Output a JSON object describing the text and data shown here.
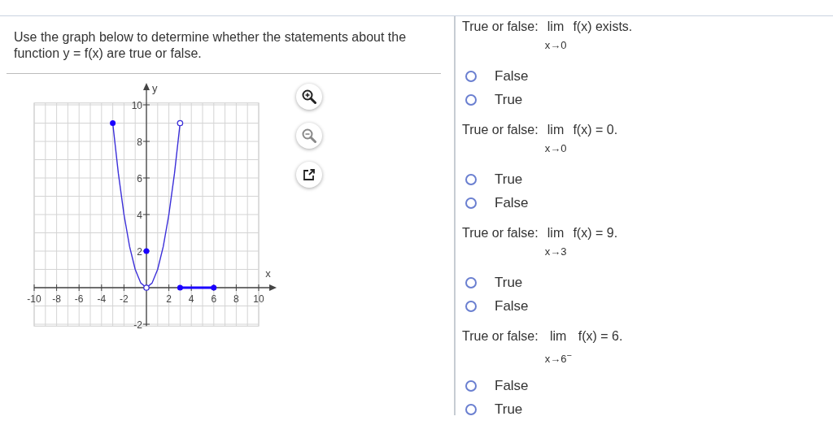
{
  "instructions": "Use the graph below to determine whether the statements about the function y = f(x) are true or false.",
  "graph": {
    "tools": [
      {
        "kind": "zoom-in"
      },
      {
        "kind": "zoom-out"
      },
      {
        "kind": "open"
      }
    ],
    "chart_data": {
      "type": "line",
      "xlabel": "x",
      "ylabel": "y",
      "grid": true,
      "x": [
        -3,
        -2.5,
        -2,
        -1.5,
        -1,
        -0.5,
        0,
        0.5,
        1,
        1.5,
        2,
        2.5,
        3,
        4,
        5,
        6
      ],
      "series": [
        {
          "color": "#3b2fd9",
          "values": [
            9,
            6.25,
            4,
            2.25,
            1,
            0.25,
            0,
            0.25,
            1,
            2.25,
            4,
            6.25,
            9,
            null,
            null,
            null
          ]
        },
        {
          "color": "#1a00ff",
          "values": [
            null,
            null,
            null,
            null,
            null,
            null,
            null,
            null,
            null,
            null,
            null,
            null,
            0,
            0,
            0,
            0
          ]
        },
        {
          "type": "scatter",
          "color": "#1a00ff",
          "values": [
            9,
            null,
            null,
            null,
            null,
            null,
            2,
            null,
            null,
            null,
            null,
            null,
            0,
            null,
            null,
            0
          ]
        },
        {
          "type": "scatter",
          "color": "#3b2fd9",
          "values": [
            null,
            null,
            null,
            null,
            null,
            null,
            0,
            null,
            null,
            null,
            null,
            null,
            9,
            null,
            null,
            null
          ]
        }
      ],
      "xlim": [
        -10,
        10
      ],
      "ylim": [
        -2,
        10
      ],
      "xticks": [
        -10,
        -8,
        -6,
        -4,
        -2,
        2,
        4,
        6,
        8,
        10
      ],
      "yticks": [
        -2,
        2,
        4,
        6,
        8,
        10
      ]
    }
  },
  "questions": [
    {
      "prefix": "True or false:",
      "lim": "lim",
      "sub": "x→0",
      "rest": "f(x) exists.",
      "options": [
        {
          "label": "False",
          "selected": false
        },
        {
          "label": "True",
          "selected": false
        }
      ]
    },
    {
      "prefix": "True or false:",
      "lim": "lim",
      "sub": "x→0",
      "rest": "f(x) = 0.",
      "options": [
        {
          "label": "True",
          "selected": false
        },
        {
          "label": "False",
          "selected": false
        }
      ]
    },
    {
      "prefix": "True or false:",
      "lim": "lim",
      "sub": "x→3",
      "rest": "f(x) = 9.",
      "options": [
        {
          "label": "True",
          "selected": false
        },
        {
          "label": "False",
          "selected": false
        }
      ]
    },
    {
      "prefix": "True or false:",
      "lim": "lim",
      "sub": "x→6$^{−}$",
      "rest": "f(x) = 6.",
      "options": [
        {
          "label": "False",
          "selected": false
        },
        {
          "label": "True",
          "selected": false
        }
      ]
    }
  ]
}
